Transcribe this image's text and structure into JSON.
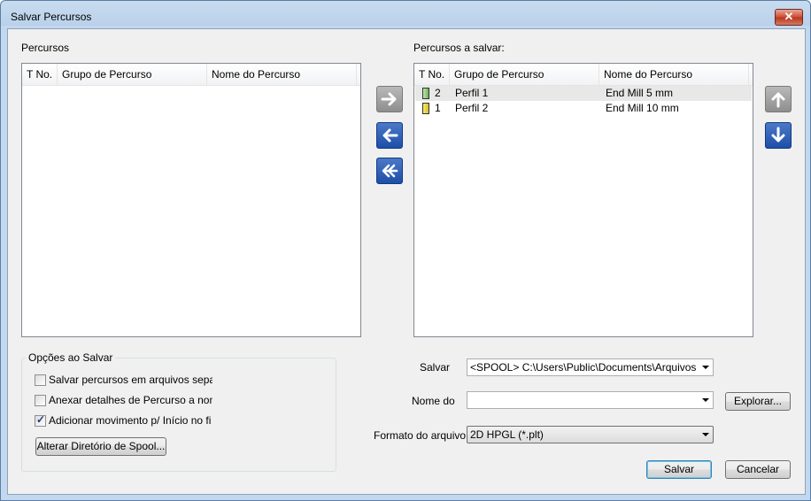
{
  "window": {
    "title": "Salvar Percursos",
    "close_label": "✕"
  },
  "left_panel": {
    "label": "Percursos",
    "columns": [
      "T No.",
      "Grupo de Percurso",
      "Nome do Percurso"
    ],
    "rows": []
  },
  "right_panel": {
    "label": "Percursos a salvar:",
    "columns": [
      "T No.",
      "Grupo de Percurso",
      "Nome do Percurso"
    ],
    "rows": [
      {
        "tno": "2",
        "group": "Perfil 1",
        "name": "End Mill 5 mm",
        "selected": true
      },
      {
        "tno": "1",
        "group": "Perfil 2",
        "name": "End Mill 10 mm",
        "selected": false
      }
    ]
  },
  "transfer_buttons": [
    "arrow-right-icon",
    "arrow-left-icon",
    "double-arrow-left-icon"
  ],
  "order_buttons": [
    "arrow-up-icon",
    "arrow-down-icon"
  ],
  "options": {
    "title": "Opções ao Salvar",
    "checkboxes": [
      {
        "label": "Salvar percursos em arquivos sepa",
        "checked": false
      },
      {
        "label": "Anexar detalhes de Percurso a nomes d",
        "checked": false
      },
      {
        "label": "Adicionar movimento p/ Início no fi",
        "checked": true
      }
    ],
    "spool_button": "Alterar Diretório de Spool..."
  },
  "save_to": {
    "label": "Salvar",
    "value": "<SPOOL> C:\\Users\\Public\\Documents\\Arquivos ArtC"
  },
  "file_name": {
    "label": "Nome do",
    "value": "",
    "browse_label": "Explorar..."
  },
  "file_format": {
    "label": "Formato do arquivo",
    "value": "2D HPGL (*.plt)"
  },
  "footer": {
    "save_label": "Salvar",
    "cancel_label": "Cancelar"
  },
  "colors": {
    "accent": "#1d4fa8",
    "disabled": "#8e8e8e",
    "titlebar": "#b9d1ea"
  }
}
